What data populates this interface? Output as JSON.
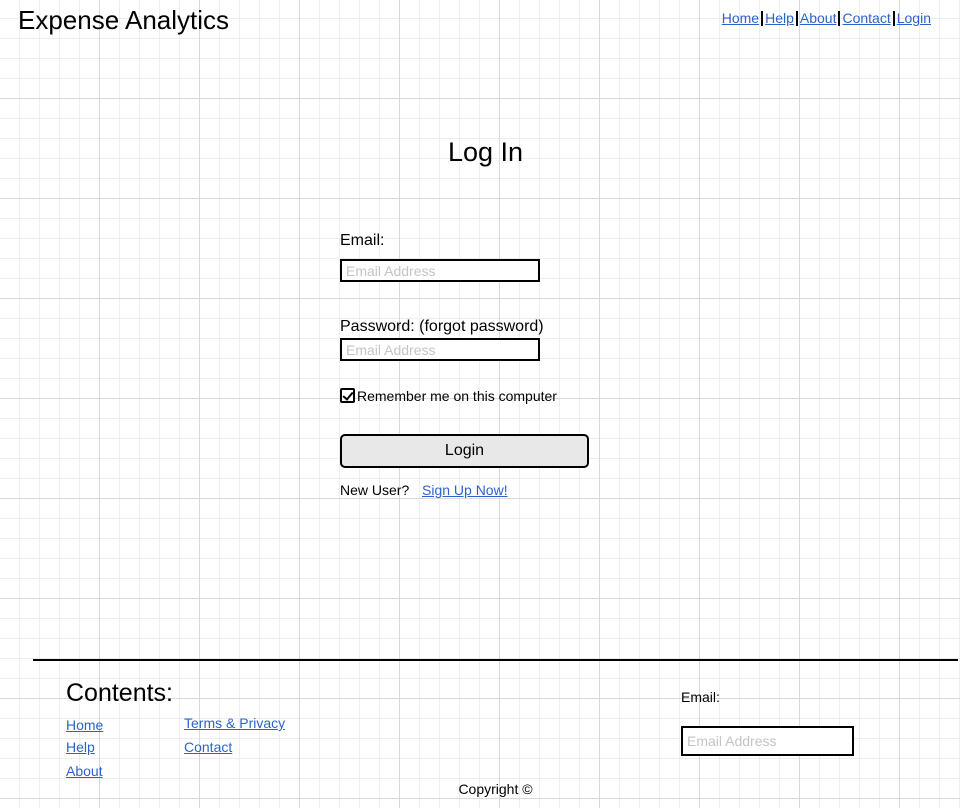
{
  "header": {
    "site_title": "Expense Analytics",
    "nav": {
      "home": "Home",
      "help": "Help",
      "about": "About",
      "contact": "Contact",
      "login": "Login"
    }
  },
  "login_form": {
    "title": "Log In",
    "email_label": "Email:",
    "email_placeholder": "Email Address",
    "email_value": "",
    "password_label": "Password: (forgot password)",
    "password_placeholder": "Email Address",
    "password_value": "",
    "remember_me_label": "Remember me on this computer",
    "remember_me_checked": true,
    "login_button": "Login",
    "new_user_text": "New User?",
    "sign_up_link": "Sign Up Now!"
  },
  "footer": {
    "contents_heading": "Contents:",
    "links_col1": [
      "Home",
      "Help",
      "About"
    ],
    "links_col2": [
      "Terms & Privacy",
      "Contact"
    ],
    "email_label": "Email:",
    "email_placeholder": "Email Address",
    "email_value": "",
    "copyright": "Copyright ©"
  },
  "colors": {
    "link": "#2d63c8",
    "button_bg": "#e8e8e8",
    "grid_major": "#d9d9d9",
    "grid_minor": "#eeeeee"
  }
}
